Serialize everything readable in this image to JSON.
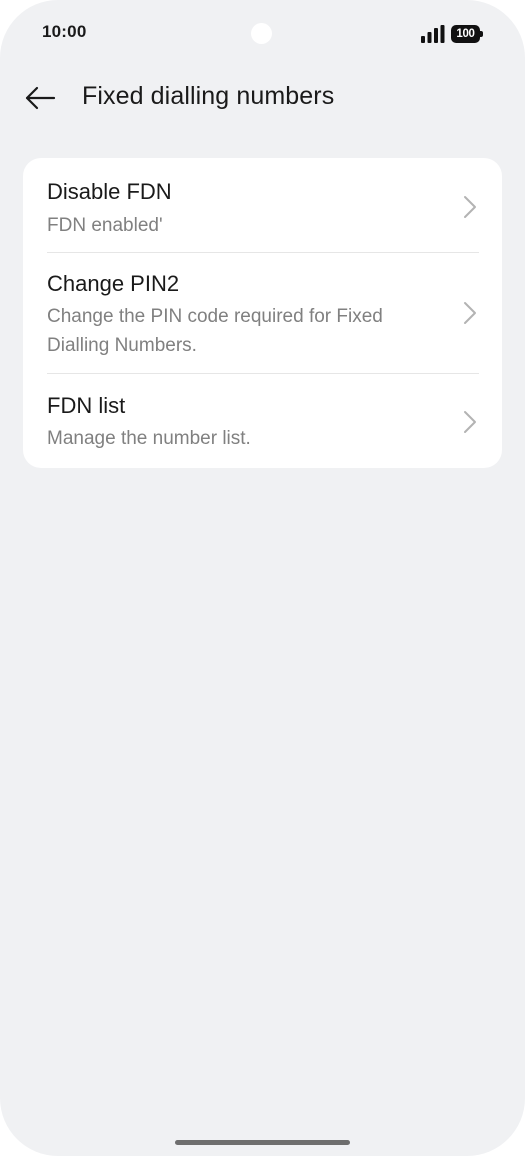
{
  "status_bar": {
    "time": "10:00",
    "battery": "100",
    "icons": [
      "signal-icon",
      "battery-icon"
    ]
  },
  "header": {
    "back_icon": "arrow-left-icon",
    "title": "Fixed dialling numbers"
  },
  "settings": {
    "items": [
      {
        "title": "Disable FDN",
        "subtitle": "FDN enabled'",
        "icon": "chevron-right-icon"
      },
      {
        "title": "Change PIN2",
        "subtitle": "Change the PIN code required for Fixed Dialling Numbers.",
        "icon": "chevron-right-icon"
      },
      {
        "title": "FDN list",
        "subtitle": "Manage the number list.",
        "icon": "chevron-right-icon"
      }
    ]
  },
  "colors": {
    "background": "#f0f1f3",
    "card": "#ffffff",
    "title_text": "#1a1a1a",
    "subtitle_text": "#808080",
    "chevron": "#b3b3b3"
  }
}
